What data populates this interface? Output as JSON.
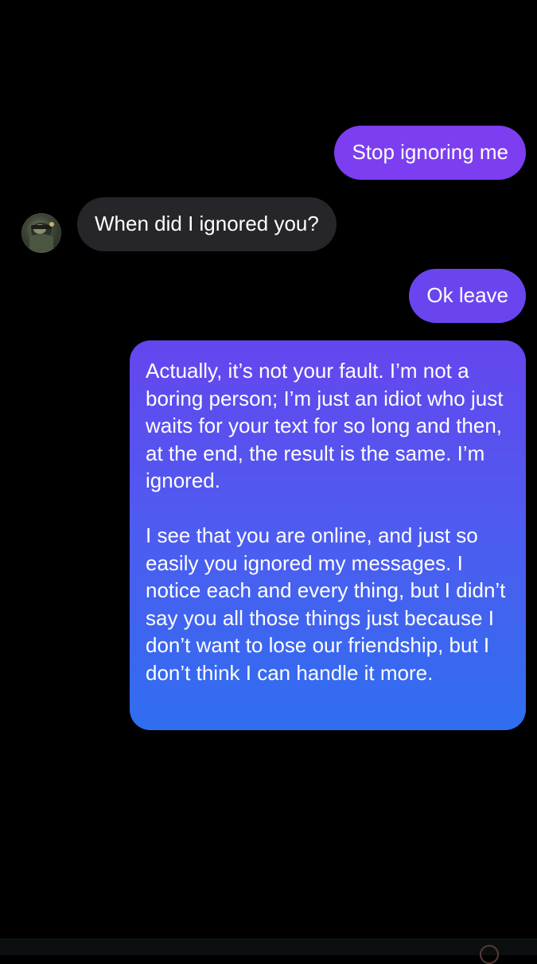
{
  "conversation": {
    "messages": [
      {
        "sender": "me",
        "text": "Stop ignoring me"
      },
      {
        "sender": "them",
        "text": "When did I ignored you?"
      },
      {
        "sender": "me",
        "text": "Ok leave"
      },
      {
        "sender": "me",
        "paragraphs": [
          "Actually, it’s not your fault. I’m not a boring person; I’m just an idiot who just waits for your text for so long and then, at the end, the result is the same. I’m ignored.",
          "I see that you are online, and just so easily you ignored my messages. I notice each and every thing, but I didn’t say you all those things just because I don’t want to lose our friendship, but I don’t think I can handle it more."
        ]
      }
    ]
  },
  "colors": {
    "background": "#000000",
    "sent_bubble_top": "#7c3ef0",
    "sent_bubble_bottom": "#2f6ef0",
    "received_bubble": "#262529",
    "text": "#ffffff"
  }
}
